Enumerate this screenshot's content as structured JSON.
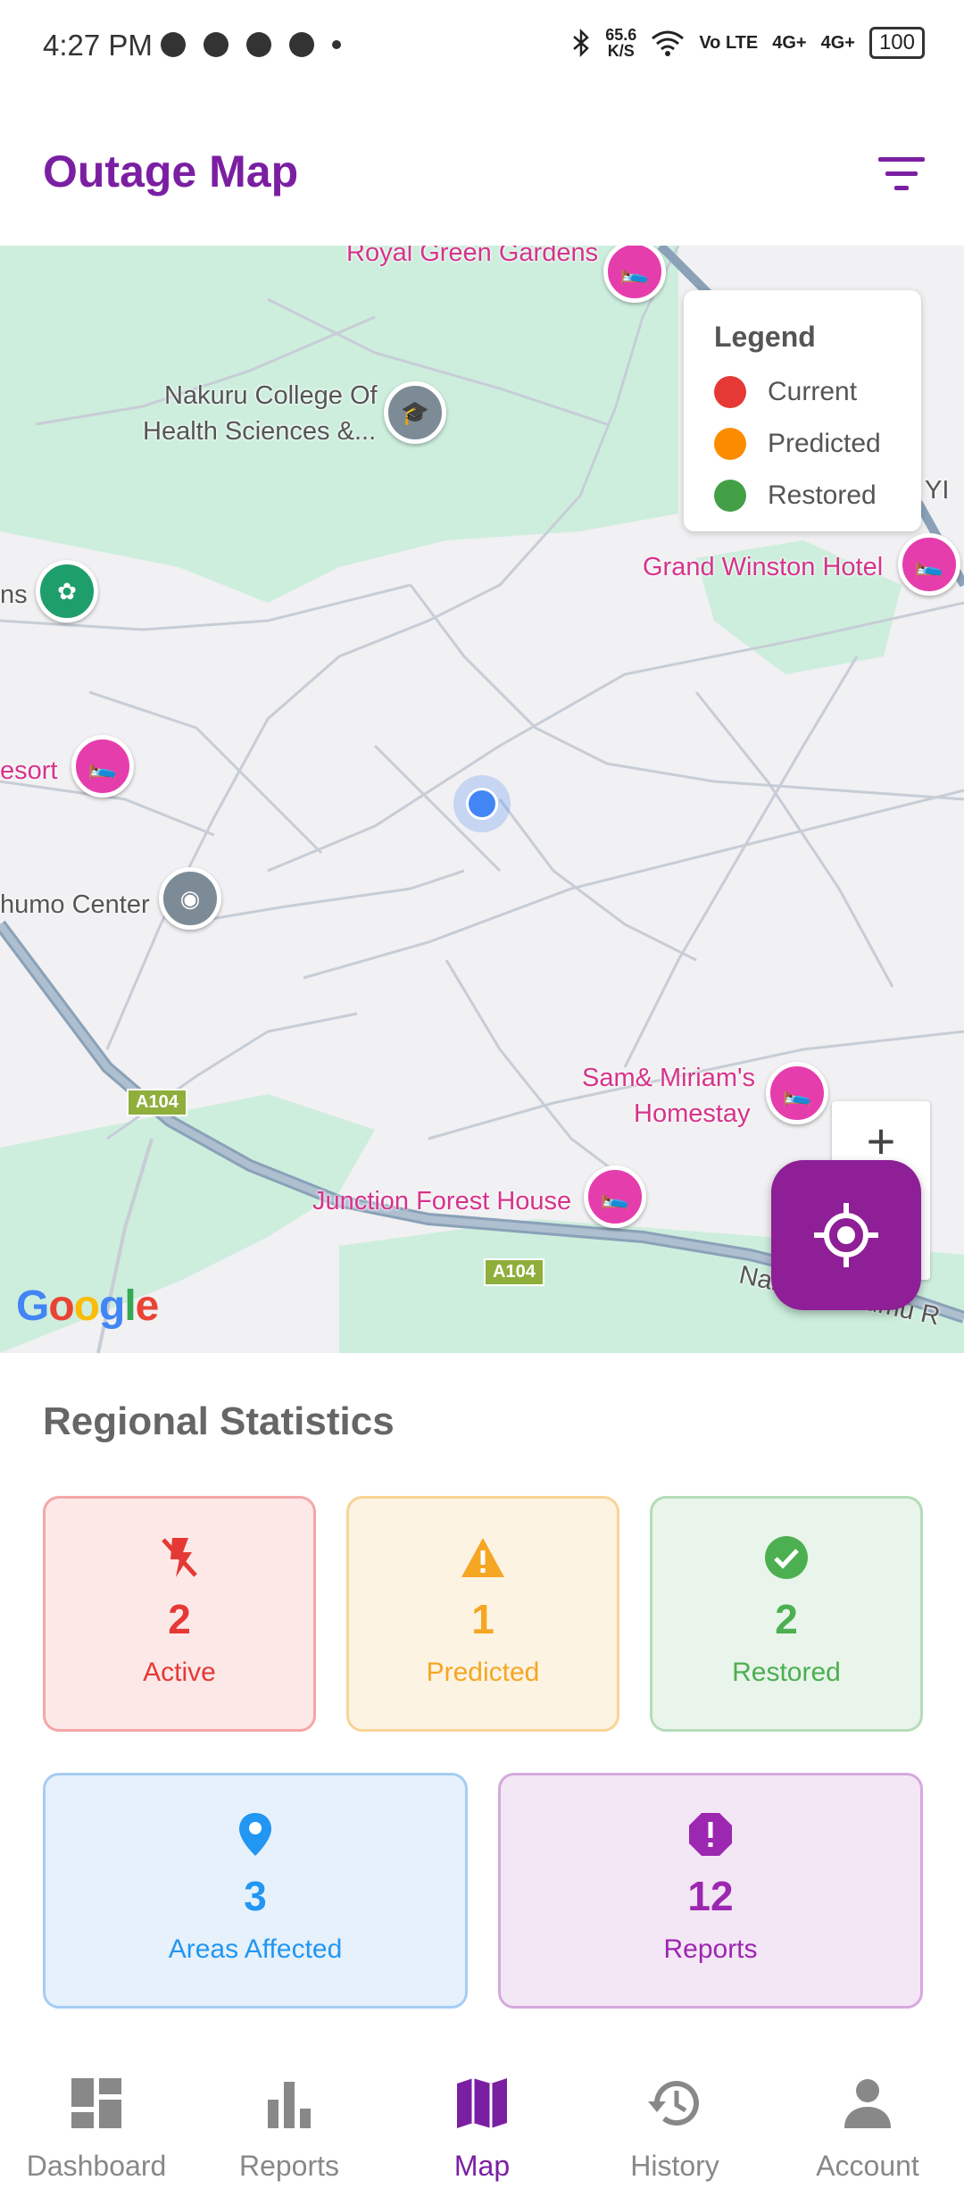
{
  "status_bar": {
    "time": "4:27 PM",
    "speed": "65.6",
    "speed_unit": "K/S",
    "network1": "Vo LTE",
    "network2": "4G+",
    "network3": "4G+",
    "battery": "100"
  },
  "header": {
    "title": "Outage Map",
    "filter_icon": "filter-list-icon"
  },
  "map": {
    "pois": {
      "royal_green": "Royal Green Gardens",
      "nakuru_college_1": "Nakuru College Of",
      "nakuru_college_2": "Health Sciences &...",
      "gardens_partial": "ns",
      "grand_winston": "Grand Winston Hotel",
      "resort_partial": "esort",
      "humo_center": "humo Center",
      "sam_miriam_1": "Sam& Miriam's",
      "sam_miriam_2": "Homestay",
      "junction_forest": "Junction Forest House",
      "nakuru_kisumu": "Nakuru-Kisumu R",
      "partial_yi": "YI"
    },
    "road_shields": [
      "A104",
      "A104"
    ],
    "google_logo": "Google",
    "zoom_in_label": "+",
    "legend": {
      "title": "Legend",
      "items": [
        {
          "label": "Current",
          "color": "#e53935"
        },
        {
          "label": "Predicted",
          "color": "#fb8c00"
        },
        {
          "label": "Restored",
          "color": "#43a047"
        }
      ]
    }
  },
  "stats": {
    "title": "Regional Statistics",
    "cards": [
      {
        "value": "2",
        "label": "Active",
        "icon": "flash-off-icon",
        "color": "#e53935",
        "bg": "#fde8e8",
        "border": "#f4a7a7"
      },
      {
        "value": "1",
        "label": "Predicted",
        "icon": "warning-icon",
        "color": "#f5a623",
        "bg": "#fdf3e3",
        "border": "#f8d495"
      },
      {
        "value": "2",
        "label": "Restored",
        "icon": "check-circle-icon",
        "color": "#4caf50",
        "bg": "#e9f4ea",
        "border": "#b5dcb8"
      },
      {
        "value": "3",
        "label": "Areas Affected",
        "icon": "location-pin-icon",
        "color": "#2196f3",
        "bg": "#e6f1fb",
        "border": "#a5cdf4"
      },
      {
        "value": "12",
        "label": "Reports",
        "icon": "report-icon",
        "color": "#9c27b0",
        "bg": "#f3e6f5",
        "border": "#d6a9de"
      }
    ]
  },
  "nav": {
    "items": [
      {
        "label": "Dashboard",
        "icon": "dashboard-icon"
      },
      {
        "label": "Reports",
        "icon": "bar-chart-icon"
      },
      {
        "label": "Map",
        "icon": "map-icon",
        "active": true
      },
      {
        "label": "History",
        "icon": "history-icon"
      },
      {
        "label": "Account",
        "icon": "person-icon"
      }
    ],
    "active_color": "#7b1fa2",
    "inactive_color": "#888888"
  }
}
